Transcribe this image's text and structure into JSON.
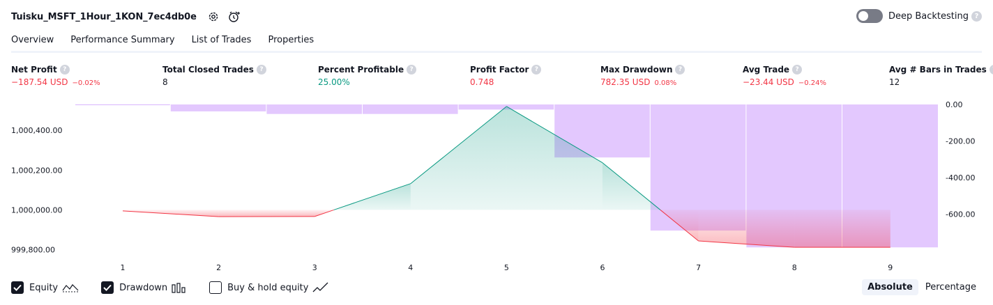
{
  "header": {
    "strategy_title": "Tuisku_MSFT_1Hour_1KON_7ec4db0e",
    "deep_backtesting_label": "Deep Backtesting",
    "help_glyph": "?"
  },
  "tabs": [
    {
      "label": "Overview",
      "active": true
    },
    {
      "label": "Performance Summary",
      "active": false
    },
    {
      "label": "List of Trades",
      "active": false
    },
    {
      "label": "Properties",
      "active": false
    }
  ],
  "metrics": [
    {
      "label": "Net Profit",
      "value": "−187.54 USD",
      "pct": "−0.02%",
      "tone": "neg"
    },
    {
      "label": "Total Closed Trades",
      "value": "8",
      "pct": "",
      "tone": "neutral"
    },
    {
      "label": "Percent Profitable",
      "value": "25.00%",
      "pct": "",
      "tone": "pos"
    },
    {
      "label": "Profit Factor",
      "value": "0.748",
      "pct": "",
      "tone": "neg"
    },
    {
      "label": "Max Drawdown",
      "value": "782.35 USD",
      "pct": "0.08%",
      "tone": "neg"
    },
    {
      "label": "Avg Trade",
      "value": "−23.44 USD",
      "pct": "−0.24%",
      "tone": "neg"
    },
    {
      "label": "Avg # Bars in Trades",
      "value": "12",
      "pct": "",
      "tone": "neutral"
    }
  ],
  "chart_data": {
    "type": "line",
    "x": [
      1,
      2,
      3,
      4,
      5,
      6,
      7,
      8,
      9
    ],
    "equity_baseline": 1000000,
    "series": [
      {
        "name": "Equity",
        "values": [
          999995,
          999966,
          999967,
          1000132,
          1000520,
          1000237,
          999844,
          999812,
          999812
        ],
        "color_up": "#089981",
        "color_down": "#f23645"
      },
      {
        "name": "Drawdown",
        "values": [
          0,
          -38,
          -52,
          -52,
          -28,
          -290,
          -690,
          -782,
          -782
        ],
        "color": "#c084fc"
      }
    ],
    "left_axis": {
      "ticks": [
        999800,
        1000000,
        1000200,
        1000400
      ],
      "tick_labels": [
        "999,800.00",
        "1,000,000.00",
        "1,000,200.00",
        "1,000,400.00"
      ],
      "range": [
        999795,
        1000530
      ]
    },
    "right_axis": {
      "ticks": [
        0,
        -200,
        -400,
        -600
      ],
      "tick_labels": [
        "0.00",
        "-200.00",
        "-400.00",
        "-600.00"
      ],
      "range": [
        -800,
        0
      ]
    }
  },
  "legend": {
    "equity": {
      "label": "Equity",
      "checked": true
    },
    "drawdown": {
      "label": "Drawdown",
      "checked": true
    },
    "buy_hold": {
      "label": "Buy & hold equity",
      "checked": false
    }
  },
  "mode": {
    "absolute": "Absolute",
    "percentage": "Percentage",
    "selected": "absolute"
  }
}
